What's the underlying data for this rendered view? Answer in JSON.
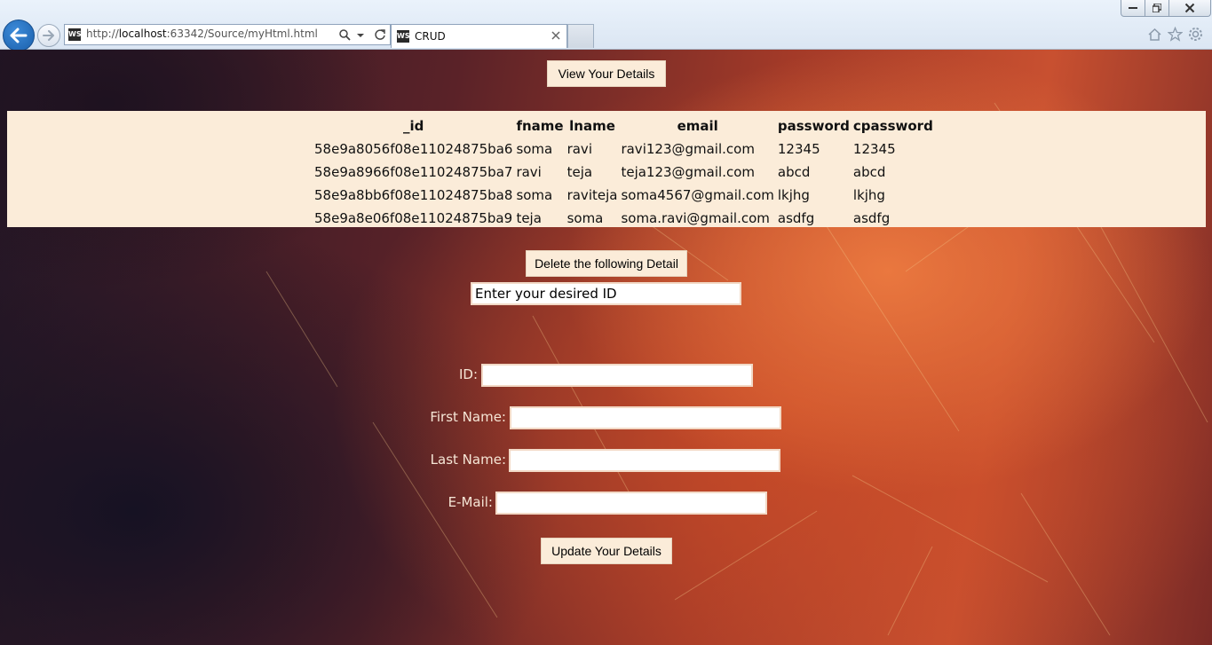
{
  "browser": {
    "url_prefix": "http://",
    "url_host": "localhost",
    "url_rest": ":63342/Source/myHtml.html",
    "tab_title": "CRUD",
    "favicon_text": "WS"
  },
  "buttons": {
    "view": "View Your Details",
    "delete": "Delete the following Detail",
    "update": "Update Your Details"
  },
  "table": {
    "headers": [
      "_id",
      "fname",
      "lname",
      "email",
      "password",
      "cpassword"
    ],
    "rows": [
      [
        "58e9a8056f08e11024875ba6",
        "soma",
        "ravi",
        "ravi123@gmail.com",
        "12345",
        "12345"
      ],
      [
        "58e9a8966f08e11024875ba7",
        "ravi",
        "teja",
        "teja123@gmail.com",
        "abcd",
        "abcd"
      ],
      [
        "58e9a8bb6f08e11024875ba8",
        "soma",
        "raviteja",
        "soma4567@gmail.com",
        "lkjhg",
        "lkjhg"
      ],
      [
        "58e9a8e06f08e11024875ba9",
        "teja",
        "soma",
        "soma.ravi@gmail.com",
        "asdfg",
        "asdfg"
      ]
    ]
  },
  "delete_field": {
    "placeholder": "Enter your desired ID"
  },
  "form": {
    "id_label": "ID:",
    "first_name_label": "First Name:",
    "last_name_label": "Last Name:",
    "email_label": "E-Mail:"
  }
}
